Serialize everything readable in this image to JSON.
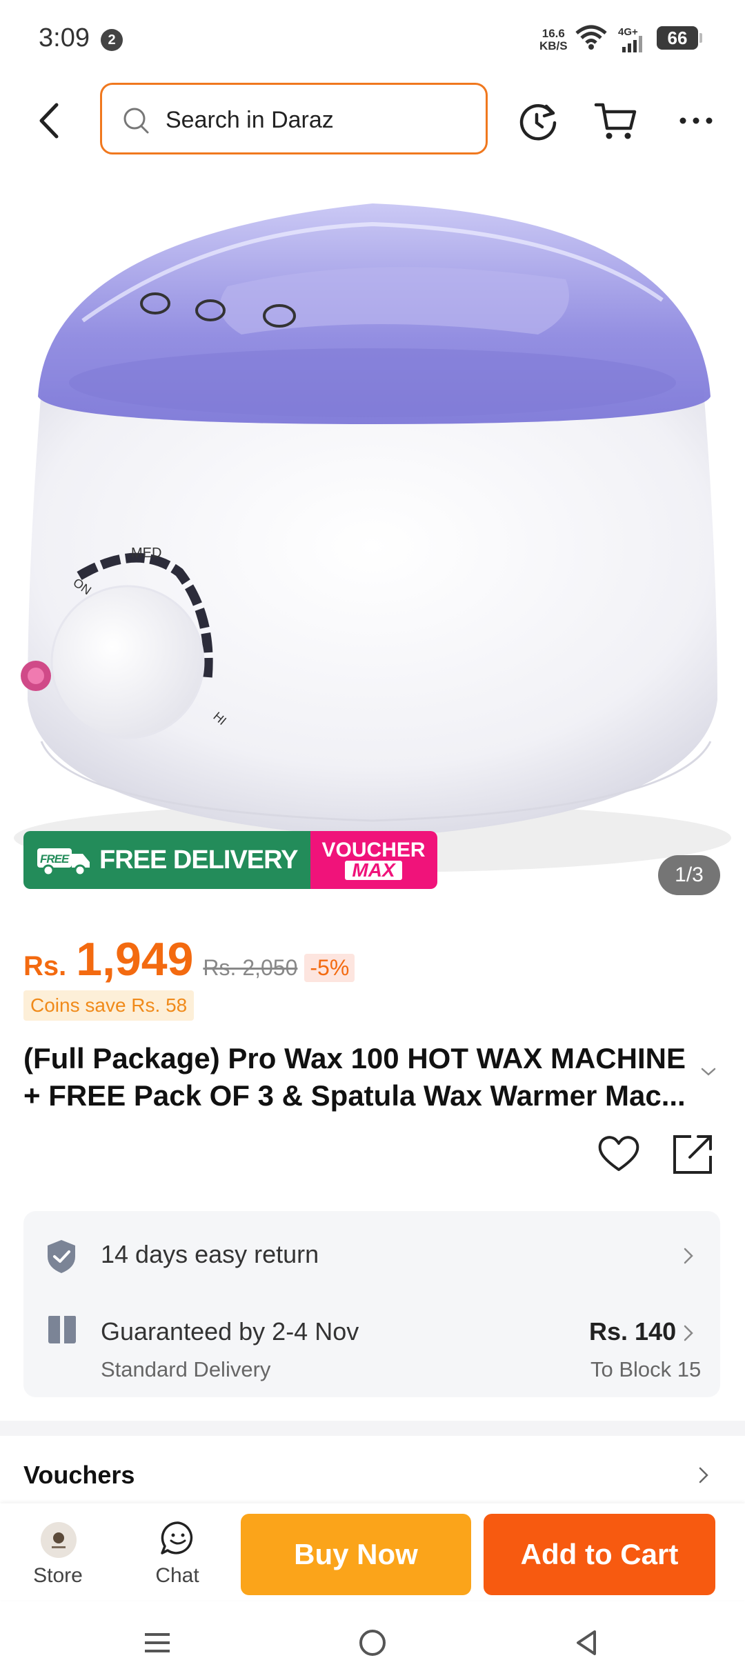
{
  "status": {
    "time": "3:09",
    "notif_count": "2",
    "speed_top": "16.6",
    "speed_unit": "KB/S",
    "network": "4G+",
    "battery": "66"
  },
  "header": {
    "search_placeholder": "Search in Daraz"
  },
  "gallery": {
    "pager": "1/3",
    "badge_free": "FREE",
    "badge_free_delivery": "FREE DELIVERY",
    "badge_voucher": "VOUCHER",
    "badge_max": "MAX",
    "knob_on": "ON",
    "knob_med": "MED",
    "knob_hi": "HI"
  },
  "price": {
    "currency": "Rs.",
    "amount": "1,949",
    "old": "Rs. 2,050",
    "discount": "-5%",
    "coins": "Coins save Rs. 58"
  },
  "product": {
    "title": "(Full Package) Pro Wax 100 HOT WAX MACHINE + FREE Pack OF 3 & Spatula Wax Warmer Mac..."
  },
  "service": {
    "return_text": "14 days easy return",
    "delivery_title": "Guaranteed by 2-4 Nov",
    "delivery_sub": "Standard Delivery",
    "delivery_price": "Rs. 140",
    "delivery_location": "To Block 15"
  },
  "vouchers": {
    "label": "Vouchers"
  },
  "bottom": {
    "store": "Store",
    "chat": "Chat",
    "buy_now": "Buy Now",
    "add_to_cart": "Add to Cart"
  },
  "colors": {
    "accent": "#f36a10",
    "buy_now": "#fba41a",
    "add_to_cart": "#f75a10",
    "free_delivery": "#238c5a",
    "voucher_max": "#f0137a"
  }
}
